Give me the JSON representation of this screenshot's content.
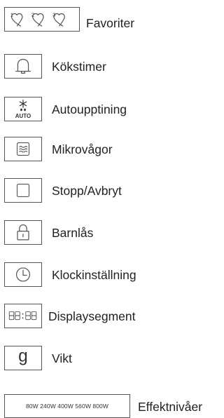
{
  "items": [
    {
      "label": "Favoriter",
      "icon": "favorites-hearts-icon"
    },
    {
      "label": "Kökstimer",
      "icon": "bell-icon"
    },
    {
      "label": "Autoupptining",
      "icon": "auto-defrost-icon",
      "icon_text": "AUTO"
    },
    {
      "label": "Mikrovågor",
      "icon": "microwave-waves-icon"
    },
    {
      "label": "Stopp/Avbryt",
      "icon": "stop-square-icon"
    },
    {
      "label": "Barnlås",
      "icon": "padlock-icon"
    },
    {
      "label": "Klockinställning",
      "icon": "clock-icon"
    },
    {
      "label": "Displaysegment",
      "icon": "display-segments-icon",
      "icon_text": "88:88"
    },
    {
      "label": "Vikt",
      "icon": "weight-g-icon",
      "icon_text": "g"
    },
    {
      "label": "Effektnivåer",
      "icon": "power-levels-icon",
      "icon_text": "80W 240W 400W 560W 800W"
    }
  ],
  "favorites": {
    "numbers": [
      "1",
      "2",
      "3"
    ]
  },
  "colors": {
    "stroke": "#555555",
    "text": "#222222",
    "background": "#ffffff"
  }
}
